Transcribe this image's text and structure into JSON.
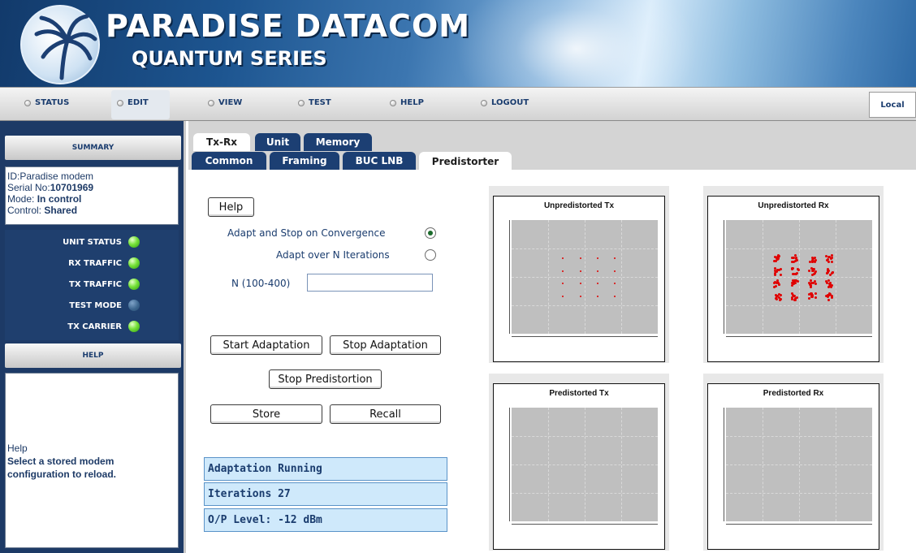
{
  "brand": {
    "title": "PARADISE DATACOM",
    "subtitle": "QUANTUM SERIES"
  },
  "nav": {
    "items": [
      {
        "label": "STATUS"
      },
      {
        "label": "EDIT"
      },
      {
        "label": "VIEW"
      },
      {
        "label": "TEST"
      },
      {
        "label": "HELP"
      },
      {
        "label": "LOGOUT"
      }
    ],
    "local": "Local"
  },
  "sidebar": {
    "summary_title": "SUMMARY",
    "summary": {
      "id_line": "ID:Paradise modem",
      "serial_label": "Serial No:",
      "serial_value": "10701969",
      "mode_label": "Mode:",
      "mode_value": "In control",
      "control_label": "Control:",
      "control_value": "Shared"
    },
    "status_items": [
      {
        "label": "UNIT STATUS",
        "state": "green"
      },
      {
        "label": "RX TRAFFIC",
        "state": "green"
      },
      {
        "label": "TX TRAFFIC",
        "state": "green"
      },
      {
        "label": "TEST MODE",
        "state": "off"
      },
      {
        "label": "TX CARRIER",
        "state": "green"
      }
    ],
    "help_title": "HELP",
    "help": {
      "line1": "Help",
      "line2": "Select a stored modem",
      "line3": "configuration to reload."
    }
  },
  "tabs": {
    "row1": [
      {
        "label": "Tx-Rx"
      },
      {
        "label": "Unit"
      },
      {
        "label": "Memory"
      }
    ],
    "row2": [
      {
        "label": "Common"
      },
      {
        "label": "Framing"
      },
      {
        "label": "BUC LNB"
      },
      {
        "label": "Predistorter"
      }
    ]
  },
  "form": {
    "help_button": "Help",
    "adapt_stop_label": "Adapt and Stop on Convergence",
    "adapt_n_label": "Adapt over N Iterations",
    "n_label": "N (100-400)",
    "n_value": "",
    "selected_mode": "adapt_stop",
    "start_button": "Start Adaptation",
    "stop_button": "Stop Adaptation",
    "stop_predistortion_button": "Stop Predistortion",
    "store_button": "Store",
    "recall_button": "Recall",
    "status_lines": [
      "Adaptation Running",
      "Iterations 27",
      "O/P Level: -12 dBm"
    ]
  },
  "plots": [
    {
      "title": "Unpredistorted Tx"
    },
    {
      "title": "Unpredistorted Rx"
    },
    {
      "title": "Predistorted Tx"
    },
    {
      "title": "Predistorted Rx"
    }
  ],
  "colors": {
    "accent": "#1c3f73",
    "led_on": "#5ccb2a",
    "point": "#e00000",
    "status_bg": "#cfe9fb"
  }
}
